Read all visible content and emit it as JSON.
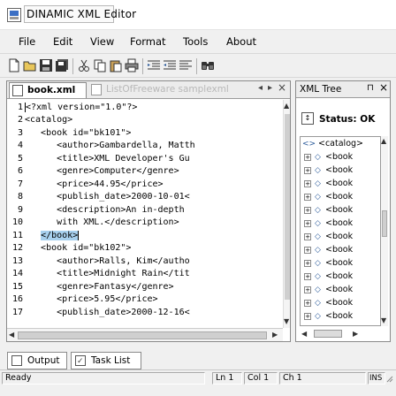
{
  "window": {
    "title": "DINAMIC XML Editor"
  },
  "menu": [
    {
      "label": "File"
    },
    {
      "label": "Edit"
    },
    {
      "label": "View"
    },
    {
      "label": "Format"
    },
    {
      "label": "Tools"
    },
    {
      "label": "About"
    }
  ],
  "toolbar": {
    "buttons": [
      "new-icon",
      "open-icon",
      "save-icon",
      "save-all-icon",
      "cut-icon",
      "copy-icon",
      "paste-icon",
      "print-icon",
      "indent-icon",
      "outdent-icon",
      "format-icon",
      "find-icon"
    ]
  },
  "editor": {
    "tabs": [
      {
        "label": "book.xml",
        "active": true
      },
      {
        "label": "ListOfFreeware samplexml",
        "active": false
      }
    ],
    "nav_prev": "◂",
    "nav_next": "▸",
    "nav_close": "×",
    "lines": [
      {
        "n": "1",
        "text": "<?xml version=\"1.0\"?>",
        "caret": true
      },
      {
        "n": "2",
        "text": "<catalog>"
      },
      {
        "n": "3",
        "text": "   <book id=\"bk101\">"
      },
      {
        "n": "4",
        "text": "      <author>Gambardella, Matth"
      },
      {
        "n": "5",
        "text": "      <title>XML Developer's Gu"
      },
      {
        "n": "6",
        "text": "      <genre>Computer</genre>"
      },
      {
        "n": "7",
        "text": "      <price>44.95</price>"
      },
      {
        "n": "8",
        "text": "      <publish_date>2000-10-01<"
      },
      {
        "n": "9",
        "text": "      <description>An in-depth"
      },
      {
        "n": "10",
        "text": "      with XML.</description>"
      },
      {
        "n": "11",
        "text": "   </book>",
        "highlight": true
      },
      {
        "n": "12",
        "text": "   <book id=\"bk102\">"
      },
      {
        "n": "13",
        "text": "      <author>Ralls, Kim</autho"
      },
      {
        "n": "14",
        "text": "      <title>Midnight Rain</tit"
      },
      {
        "n": "15",
        "text": "      <genre>Fantasy</genre>"
      },
      {
        "n": "16",
        "text": "      <price>5.95</price>"
      },
      {
        "n": "17",
        "text": "      <publish_date>2000-12-16<"
      }
    ]
  },
  "tree": {
    "title": "XML Tree",
    "pin": "⊓",
    "close": "×",
    "status_label": "Status: OK",
    "status_icon": "↕",
    "nodes": [
      {
        "label": "<catalog>",
        "root": true
      },
      {
        "label": "<book"
      },
      {
        "label": "<book"
      },
      {
        "label": "<book"
      },
      {
        "label": "<book"
      },
      {
        "label": "<book"
      },
      {
        "label": "<book"
      },
      {
        "label": "<book"
      },
      {
        "label": "<book"
      },
      {
        "label": "<book"
      },
      {
        "label": "<book"
      },
      {
        "label": "<book"
      },
      {
        "label": "<book"
      },
      {
        "label": "<book"
      }
    ]
  },
  "bottom_tabs": [
    {
      "label": "Output"
    },
    {
      "label": "Task List"
    }
  ],
  "statusbar": {
    "ready": "Ready",
    "ln": "Ln 1",
    "col": "Col 1",
    "ch": "Ch 1",
    "ins": "INS"
  },
  "colors": {
    "selection": "#a8d0ee",
    "window_bg": "#f0f0f0"
  }
}
